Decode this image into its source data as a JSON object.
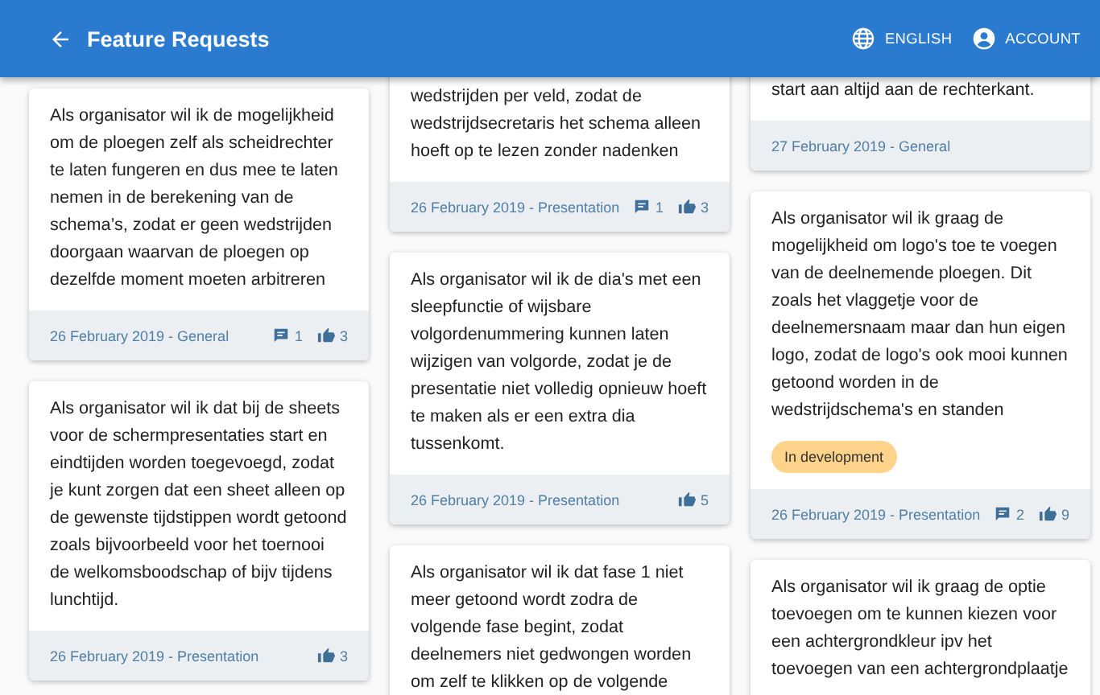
{
  "app_bar": {
    "title": "Feature Requests",
    "actions": [
      {
        "kind": "language",
        "label": "ENGLISH"
      },
      {
        "kind": "account",
        "label": "ACCOUNT"
      }
    ]
  },
  "columns": [
    {
      "cards": [
        {
          "text": "Als organisator wil ik de mogelijkheid om de ploegen zelf als scheidrechter te laten fungeren en dus mee te laten nemen in de berekening van de schema’s, zodat er geen wedstrijden doorgaan waarvan de ploegen op dezelfde moment moeten arbitreren",
          "meta": "26 February 2019 - General",
          "comments": "1",
          "likes": "3"
        },
        {
          "text": "Als organisator wil ik dat bij de sheets voor de schermpresentaties start en eindtijden worden toegevoegd, zodat je kunt zorgen dat een sheet alleen op de gewenste tijdstippen wordt getoond zoals bijvoorbeeld voor het toernooi de welkomsboodschap of bijv tijdens lunchtijd.",
          "meta": "26 February 2019 - Presentation",
          "likes": "3"
        }
      ]
    },
    {
      "cards": [
        {
          "text": "wedstrijden per veld, zodat de wedstrijdsecretaris het schema alleen hoeft op te lezen zonder nadenken",
          "meta": "26 February 2019 - Presentation",
          "comments": "1",
          "likes": "3"
        },
        {
          "text": "Als organisator wil ik de dia's met een sleepfunctie of wijsbare volgordenummering kunnen laten wijzigen van volgorde, zodat je de presentatie niet volledig opnieuw hoeft te maken als er een extra dia tussenkomt.",
          "meta": "26 February 2019 - Presentation",
          "likes": "5"
        },
        {
          "text": "Als organisator wil ik dat fase 1 niet meer getoond wordt zodra de volgende fase begint, zodat deelnemers niet gedwongen worden om zelf te klikken op de volgende"
        }
      ]
    },
    {
      "cards": [
        {
          "text": "start aan altijd aan de rechterkant.",
          "meta": "27 February 2019 - General"
        },
        {
          "text": "Als organisator wil ik graag de mogelijkheid om logo's toe te voegen van de deelnemende ploegen. Dit zoals het vlaggetje voor de deelnemersnaam maar dan hun eigen logo, zodat de logo's ook mooi kunnen getoond worden in de wedstrijdschema's en standen",
          "status": "In development",
          "meta": "26 February 2019 - Presentation",
          "comments": "2",
          "likes": "9"
        },
        {
          "text": "Als organisator wil ik graag de optie toevoegen om te kunnen kiezen voor een achtergrondkleur ipv het toevoegen van een achtergrondplaatje"
        }
      ]
    }
  ]
}
